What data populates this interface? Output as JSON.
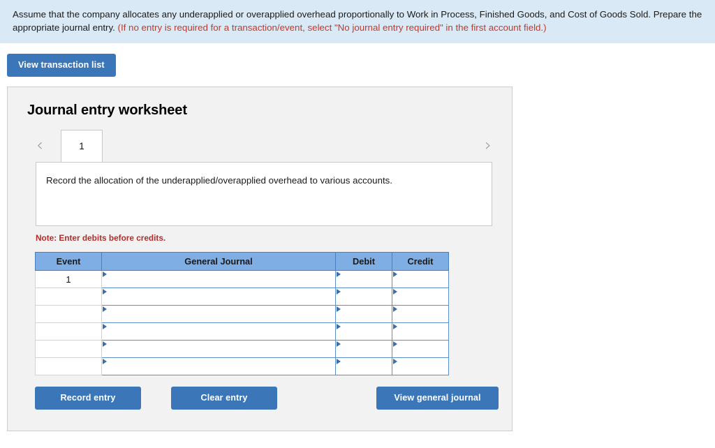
{
  "banner": {
    "text_normal": "Assume that the company allocates any underapplied or overapplied overhead proportionally to Work in Process, Finished Goods, and Cost of Goods Sold. Prepare the appropriate journal entry.",
    "text_red": "(If no entry is required for a transaction/event, select \"No journal entry required\" in the first account field.)",
    "background_color": "#d9e9f6",
    "red_color": "#c0392b"
  },
  "toolbar": {
    "view_transaction_list_label": "View transaction list"
  },
  "worksheet": {
    "title": "Journal entry worksheet",
    "prev_icon": "chevron-left-icon",
    "next_icon": "chevron-right-icon",
    "tabs": [
      {
        "label": "1",
        "active": true
      }
    ],
    "description": "Record the allocation of the underapplied/overapplied overhead to various accounts.",
    "note": "Note: Enter debits before credits.",
    "table": {
      "headers": [
        "Event",
        "General Journal",
        "Debit",
        "Credit"
      ],
      "rows": [
        {
          "event": "1",
          "general_journal": "",
          "debit": "",
          "credit": ""
        },
        {
          "event": "",
          "general_journal": "",
          "debit": "",
          "credit": ""
        },
        {
          "event": "",
          "general_journal": "",
          "debit": "",
          "credit": ""
        },
        {
          "event": "",
          "general_journal": "",
          "debit": "",
          "credit": ""
        },
        {
          "event": "",
          "general_journal": "",
          "debit": "",
          "credit": ""
        },
        {
          "event": "",
          "general_journal": "",
          "debit": "",
          "credit": ""
        }
      ],
      "header_color": "#7eaee4",
      "cell_border_color": "#5b8fc9",
      "marker_icon": "dropdown-triangle-icon"
    },
    "buttons": {
      "record_entry_label": "Record entry",
      "clear_entry_label": "Clear entry",
      "view_general_journal_label": "View general journal",
      "color": "#3b77b8"
    }
  }
}
